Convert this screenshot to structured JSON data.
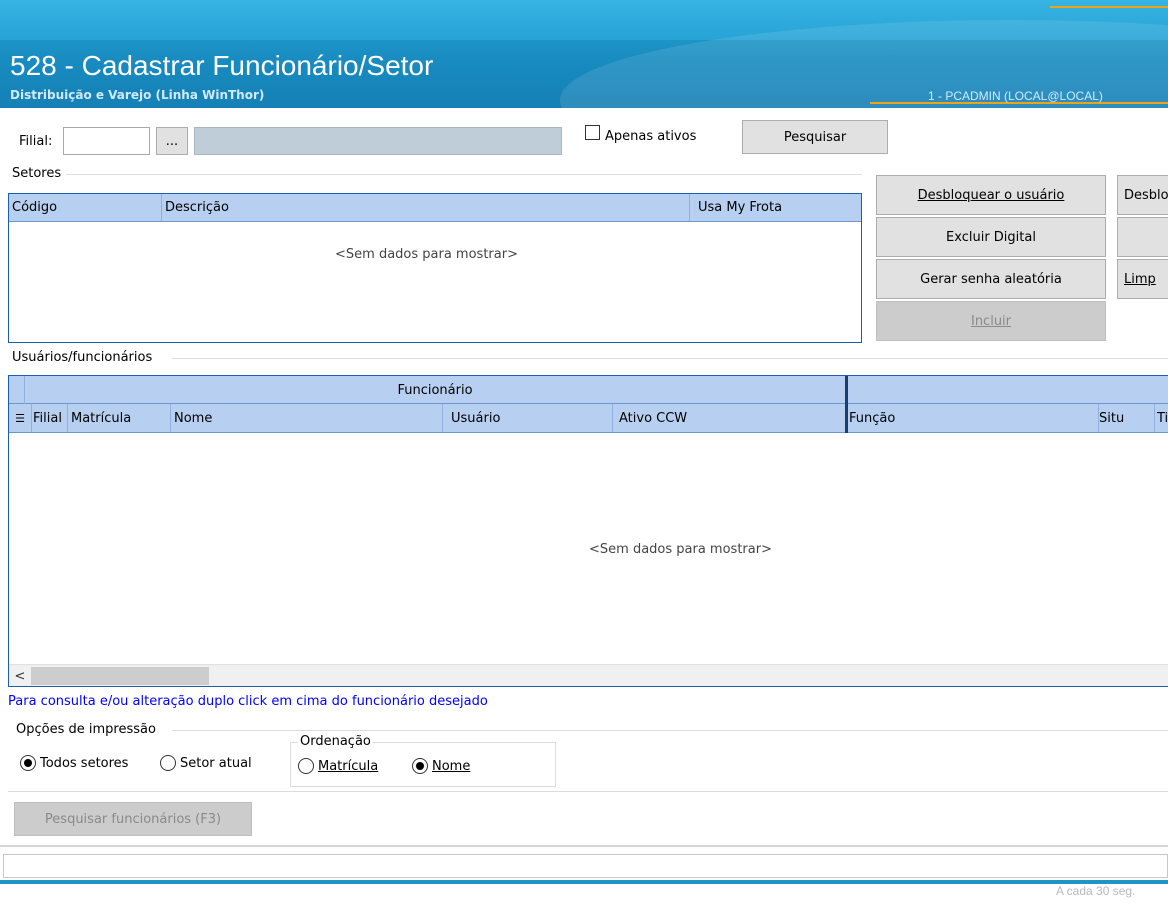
{
  "header": {
    "title": "528 - Cadastrar Funcionário/Setor",
    "subtitle": "Distribuição e Varejo (Linha WinThor)",
    "user": "1 - PCADMIN (LOCAL@LOCAL)"
  },
  "filter": {
    "filial_label": "Filial:",
    "filial_value": "",
    "lookup_button": "...",
    "filial_name": "",
    "active_only_label": "Apenas ativos",
    "active_only_checked": false,
    "search_button": "Pesquisar"
  },
  "sectors": {
    "group_label": "Setores",
    "columns": [
      "Código",
      "Descrição",
      "Usa My Frota"
    ],
    "empty_text": "<Sem dados para mostrar>"
  },
  "actions": {
    "unblock_user": "Desbloquear o usuário",
    "unblock_other": "Desblo",
    "delete_digital": "Excluir Digital",
    "random_password": "Gerar senha aleatória",
    "clear": "Limp",
    "include": "Incluir"
  },
  "employees": {
    "group_label": "Usuários/funcionários",
    "band_label": "Funcionário",
    "columns": [
      "Filial",
      "Matrícula",
      "Nome",
      "Usuário",
      "Ativo CCW",
      "Função",
      "Situ",
      "Ti"
    ],
    "empty_text": "<Sem dados para mostrar>",
    "hint": "Para consulta e/ou alteração duplo click em cima do funcionário desejado"
  },
  "print_options": {
    "group_label": "Opções de impressão",
    "all_sectors": "Todos setores",
    "current_sector": "Setor atual",
    "selected": "all_sectors"
  },
  "ordering": {
    "group_label": "Ordenação",
    "by_registration": "Matrícula",
    "by_name": "Nome",
    "selected": "by_name"
  },
  "bottom": {
    "search_employees": "Pesquisar funcionários (F3)",
    "status_text": "A cada 30 seg."
  },
  "colors": {
    "header": "#1e95c7",
    "accent": "#f2a21a",
    "grid_header": "#b7d0f1",
    "hint_text": "#0000ff"
  }
}
